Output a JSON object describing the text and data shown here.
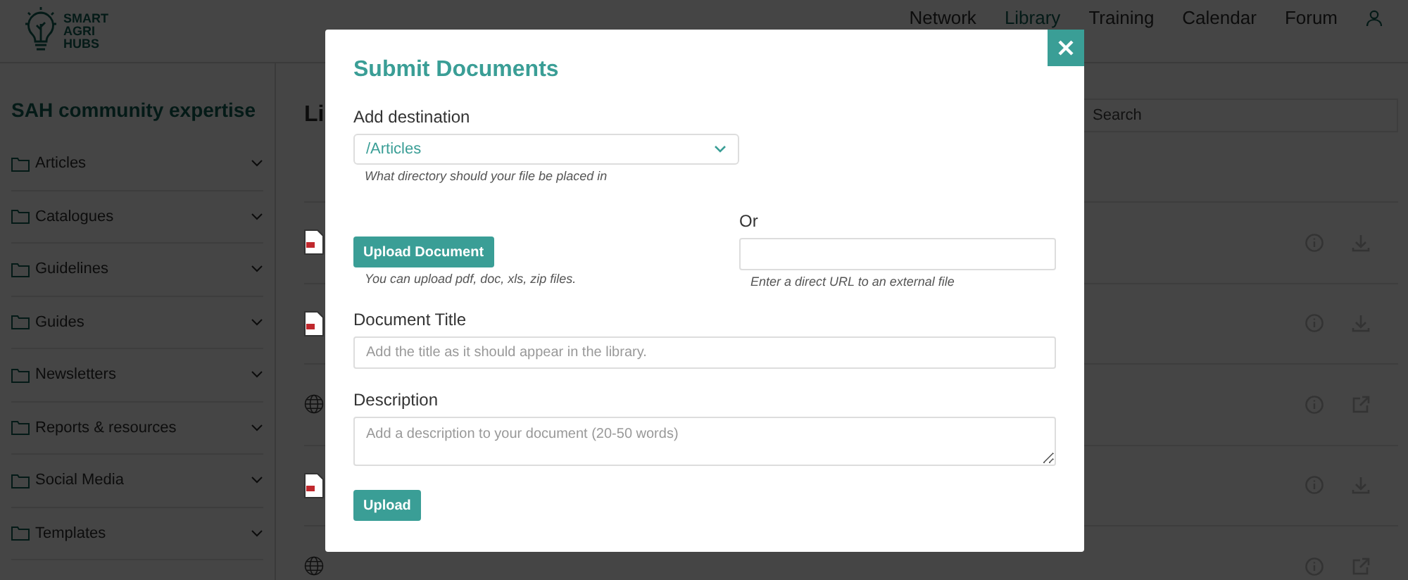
{
  "header": {
    "logo": [
      "SMART",
      "AGRI",
      "HUBS"
    ],
    "nav": [
      {
        "label": "Network",
        "selected": false
      },
      {
        "label": "Library",
        "selected": true
      },
      {
        "label": "Training",
        "selected": false
      },
      {
        "label": "Calendar",
        "selected": false
      },
      {
        "label": "Forum",
        "selected": false
      }
    ]
  },
  "sidebar": {
    "title": "SAH community expertise",
    "folders": [
      {
        "label": "Articles",
        "expanded": false
      },
      {
        "label": "Catalogues",
        "expanded": false
      },
      {
        "label": "Guidelines",
        "expanded": false
      },
      {
        "label": "Guides",
        "expanded": false
      },
      {
        "label": "Newsletters",
        "expanded": false
      },
      {
        "label": "Reports & resources",
        "expanded": false
      },
      {
        "label": "Social Media",
        "expanded": false
      },
      {
        "label": "Templates",
        "expanded": false
      }
    ]
  },
  "library": {
    "heading": "Li",
    "search": {
      "placeholder": "Search"
    },
    "rows": [
      {
        "kind": "file"
      },
      {
        "kind": "file"
      },
      {
        "kind": "link"
      },
      {
        "kind": "file"
      },
      {
        "kind": "link"
      }
    ]
  },
  "modal": {
    "title": "Submit Documents",
    "destination_label": "Add destination",
    "destination_value": "/Articles",
    "destination_hint": "What directory should your file be placed in",
    "upload_button": "Upload Document",
    "upload_hint": "You can upload pdf, doc, xls, zip files.",
    "or_label": "Or",
    "url_hint": "Enter a direct URL to an external file",
    "title_label": "Document Title",
    "title_placeholder": "Add the title as it should appear in the library.",
    "description_label": "Description",
    "description_placeholder": "Add a description to your document (20-50 words)",
    "submit_button": "Upload"
  }
}
